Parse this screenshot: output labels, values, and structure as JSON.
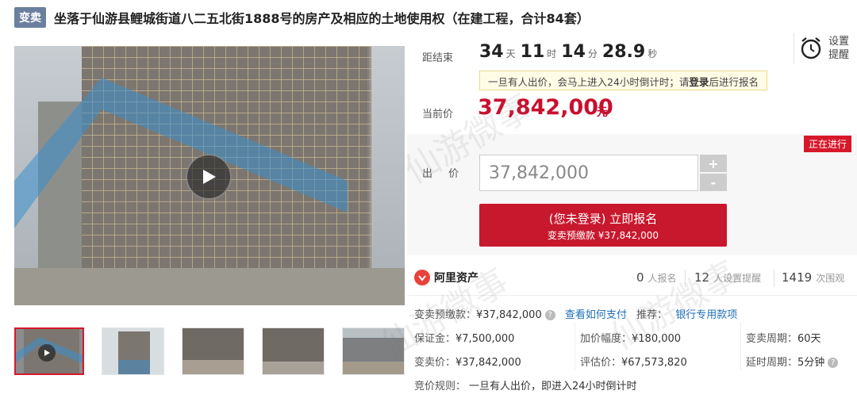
{
  "header": {
    "tag": "变卖",
    "title": "坐落于仙游县鲤城街道八二五北街1888号的房产及相应的土地使用权（在建工程，合计84套）"
  },
  "countdown": {
    "label": "距结束",
    "days": "34",
    "days_unit": "天",
    "hours": "11",
    "hours_unit": "时",
    "minutes": "14",
    "minutes_unit": "分",
    "seconds": "28.9",
    "seconds_unit": "秒"
  },
  "reminder": {
    "label": "设置提醒",
    "icon": "alarm-clock-icon"
  },
  "notice": {
    "text_before": "一旦有人出价，会马上进入24小时倒计时；请",
    "login": "登录",
    "text_after": "后进行报名"
  },
  "price": {
    "label": "当前价",
    "value": "37,842,000",
    "unit": "元",
    "color": "#c8102e"
  },
  "status": {
    "label": "正在进行"
  },
  "bid": {
    "label": "出 价",
    "value": "37,842,000",
    "plus": "+",
    "minus": "-"
  },
  "signup": {
    "line1": "(您未登录) 立即报名",
    "line2": "变卖预缴款 ¥37,842,000"
  },
  "platform": {
    "name": "阿里资产"
  },
  "stats": [
    {
      "value": "0",
      "label": "人报名"
    },
    {
      "value": "12",
      "label": "人设置提醒"
    },
    {
      "value": "1419",
      "label": "次围观"
    }
  ],
  "deposit_row": {
    "label": "变卖预缴款：",
    "value": "¥37,842,000",
    "how_to_pay": "查看如何支付",
    "recommend_label": "推荐：",
    "recommend_link": "银行专用款项"
  },
  "details": {
    "guarantee": {
      "label": "保证金：",
      "value": "¥7,500,000"
    },
    "increment": {
      "label": "加价幅度：",
      "value": "¥180,000"
    },
    "period": {
      "label": "变卖周期：",
      "value": "60天"
    },
    "sale_price": {
      "label": "变卖价：",
      "value": "¥37,842,000"
    },
    "appraisal": {
      "label": "评估价：",
      "value": "¥67,573,820"
    },
    "delay": {
      "label": "延时周期：",
      "value": "5分钟"
    }
  },
  "rule": {
    "label": "竞价规则：",
    "value": "一旦有人出价，即进入24小时倒计时"
  },
  "colors": {
    "accent_red": "#d7182a",
    "tag_bg": "#6b7f9e",
    "link_blue": "#1d6fb8"
  }
}
